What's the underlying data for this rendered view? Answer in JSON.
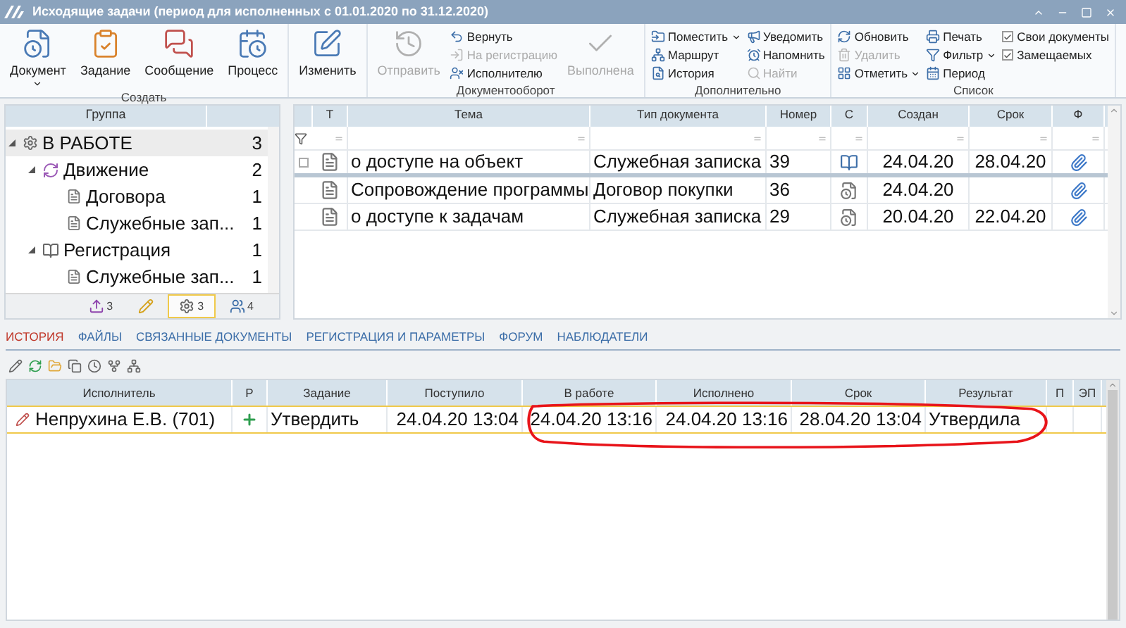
{
  "window": {
    "title": "Исходящие задачи (период для исполненных с 01.01.2020 по 31.12.2020)"
  },
  "ribbon": {
    "groups": [
      {
        "label": "Создать",
        "items": [
          {
            "kind": "large",
            "label": "Документ",
            "disabled": false,
            "dropdown": true
          },
          {
            "kind": "large",
            "label": "Задание",
            "disabled": false,
            "dropdown": false
          },
          {
            "kind": "large",
            "label": "Сообщение",
            "disabled": false,
            "dropdown": false
          },
          {
            "kind": "large",
            "label": "Процесс",
            "disabled": false,
            "dropdown": false
          }
        ]
      },
      {
        "items": [
          {
            "kind": "large",
            "label": "Изменить",
            "disabled": false,
            "dropdown": false
          }
        ]
      },
      {
        "label": "Документооборот",
        "items": [
          {
            "kind": "large",
            "label": "Отправить",
            "disabled": true,
            "dropdown": false
          },
          {
            "kind": "small",
            "label": "Вернуть",
            "disabled": false,
            "dropdown": false
          },
          {
            "kind": "small",
            "label": "На регистрацию",
            "disabled": true,
            "dropdown": false
          },
          {
            "kind": "small",
            "label": "Исполнителю",
            "disabled": false,
            "dropdown": false
          },
          {
            "kind": "large",
            "label": "Выполнена",
            "disabled": true,
            "dropdown": false
          }
        ]
      },
      {
        "label": "Дополнительно",
        "items": [
          {
            "kind": "small",
            "label": "Поместить",
            "disabled": false,
            "dropdown": true
          },
          {
            "kind": "small",
            "label": "Маршрут",
            "disabled": false,
            "dropdown": false
          },
          {
            "kind": "small",
            "label": "История",
            "disabled": false,
            "dropdown": false
          },
          {
            "kind": "small",
            "label": "Уведомить",
            "disabled": false,
            "dropdown": false
          },
          {
            "kind": "small",
            "label": "Напомнить",
            "disabled": false,
            "dropdown": false
          },
          {
            "kind": "small",
            "label": "Найти",
            "disabled": true,
            "dropdown": false
          }
        ]
      },
      {
        "label": "Список",
        "items": [
          {
            "kind": "small",
            "label": "Обновить",
            "disabled": false,
            "dropdown": false
          },
          {
            "kind": "small",
            "label": "Удалить",
            "disabled": true,
            "dropdown": false
          },
          {
            "kind": "small",
            "label": "Отметить",
            "disabled": false,
            "dropdown": true
          },
          {
            "kind": "small",
            "label": "Печать",
            "disabled": false,
            "dropdown": false
          },
          {
            "kind": "small",
            "label": "Фильтр",
            "disabled": false,
            "dropdown": true
          },
          {
            "kind": "small",
            "label": "Период",
            "disabled": false,
            "dropdown": false
          },
          {
            "kind": "check",
            "label": "Свои документы",
            "checked": true
          },
          {
            "kind": "check",
            "label": "Замещаемых",
            "checked": true
          }
        ]
      }
    ]
  },
  "groups_panel": {
    "header": "Группа",
    "tree": [
      {
        "label": "В РАБОТЕ",
        "count": "3",
        "selected": true,
        "expanded": true,
        "children": [
          {
            "label": "Движение",
            "count": "2",
            "selected": false,
            "expanded": true,
            "children": [
              {
                "label": "Договора",
                "count": "1",
                "selected": false
              },
              {
                "label": "Служебные зап...",
                "count": "1",
                "selected": false
              }
            ]
          },
          {
            "label": "Регистрация",
            "count": "1",
            "selected": false,
            "expanded": true,
            "children": [
              {
                "label": "Служебные зап...",
                "count": "1",
                "selected": false
              }
            ]
          }
        ]
      }
    ],
    "view_tabs": [
      {
        "count": "3",
        "selected": false
      },
      {
        "selected": false
      },
      {
        "count": "3",
        "selected": true
      },
      {
        "count": "4",
        "selected": false
      }
    ]
  },
  "documents": {
    "columns": [
      "Т",
      "Тема",
      "Тип документа",
      "Номер",
      "С",
      "Создан",
      "Срок",
      "Ф"
    ],
    "rows": [
      {
        "subject": "о доступе на объект",
        "type": "Служебная записка",
        "number": "39",
        "kind": "book",
        "created": "24.04.20",
        "due": "28.04.20",
        "attached": true,
        "focused": true
      },
      {
        "subject": "Сопровождение программы",
        "type": "Договор покупки",
        "number": "36",
        "kind": "clock",
        "created": "24.04.20",
        "attached": true,
        "focused": false
      },
      {
        "subject": "о доступе к задачам",
        "type": "Служебная записка",
        "number": "29",
        "kind": "clock",
        "created": "20.04.20",
        "due": "22.04.20",
        "attached": true,
        "focused": false
      }
    ]
  },
  "detail_tabs": [
    {
      "label": "ИСТОРИЯ",
      "selected": true
    },
    {
      "label": "ФАЙЛЫ",
      "selected": false
    },
    {
      "label": "СВЯЗАННЫЕ ДОКУМЕНТЫ",
      "selected": false
    },
    {
      "label": "РЕГИСТРАЦИЯ И ПАРАМЕТРЫ",
      "selected": false
    },
    {
      "label": "ФОРУМ",
      "selected": false
    },
    {
      "label": "НАБЛЮДАТЕЛИ",
      "selected": false
    }
  ],
  "history": {
    "columns": [
      "Исполнитель",
      "Р",
      "Задание",
      "Поступило",
      "В работе",
      "Исполнено",
      "Срок",
      "Результат",
      "П",
      "ЭП"
    ],
    "rows": [
      {
        "executor": "Непрухина Е.В. (701)",
        "task": "Утвердить",
        "received": "24.04.20 13:04",
        "in_work": "24.04.20 13:16",
        "done": "24.04.20 13:16",
        "due": "28.04.20 13:04",
        "result": "Утвердила"
      }
    ]
  }
}
